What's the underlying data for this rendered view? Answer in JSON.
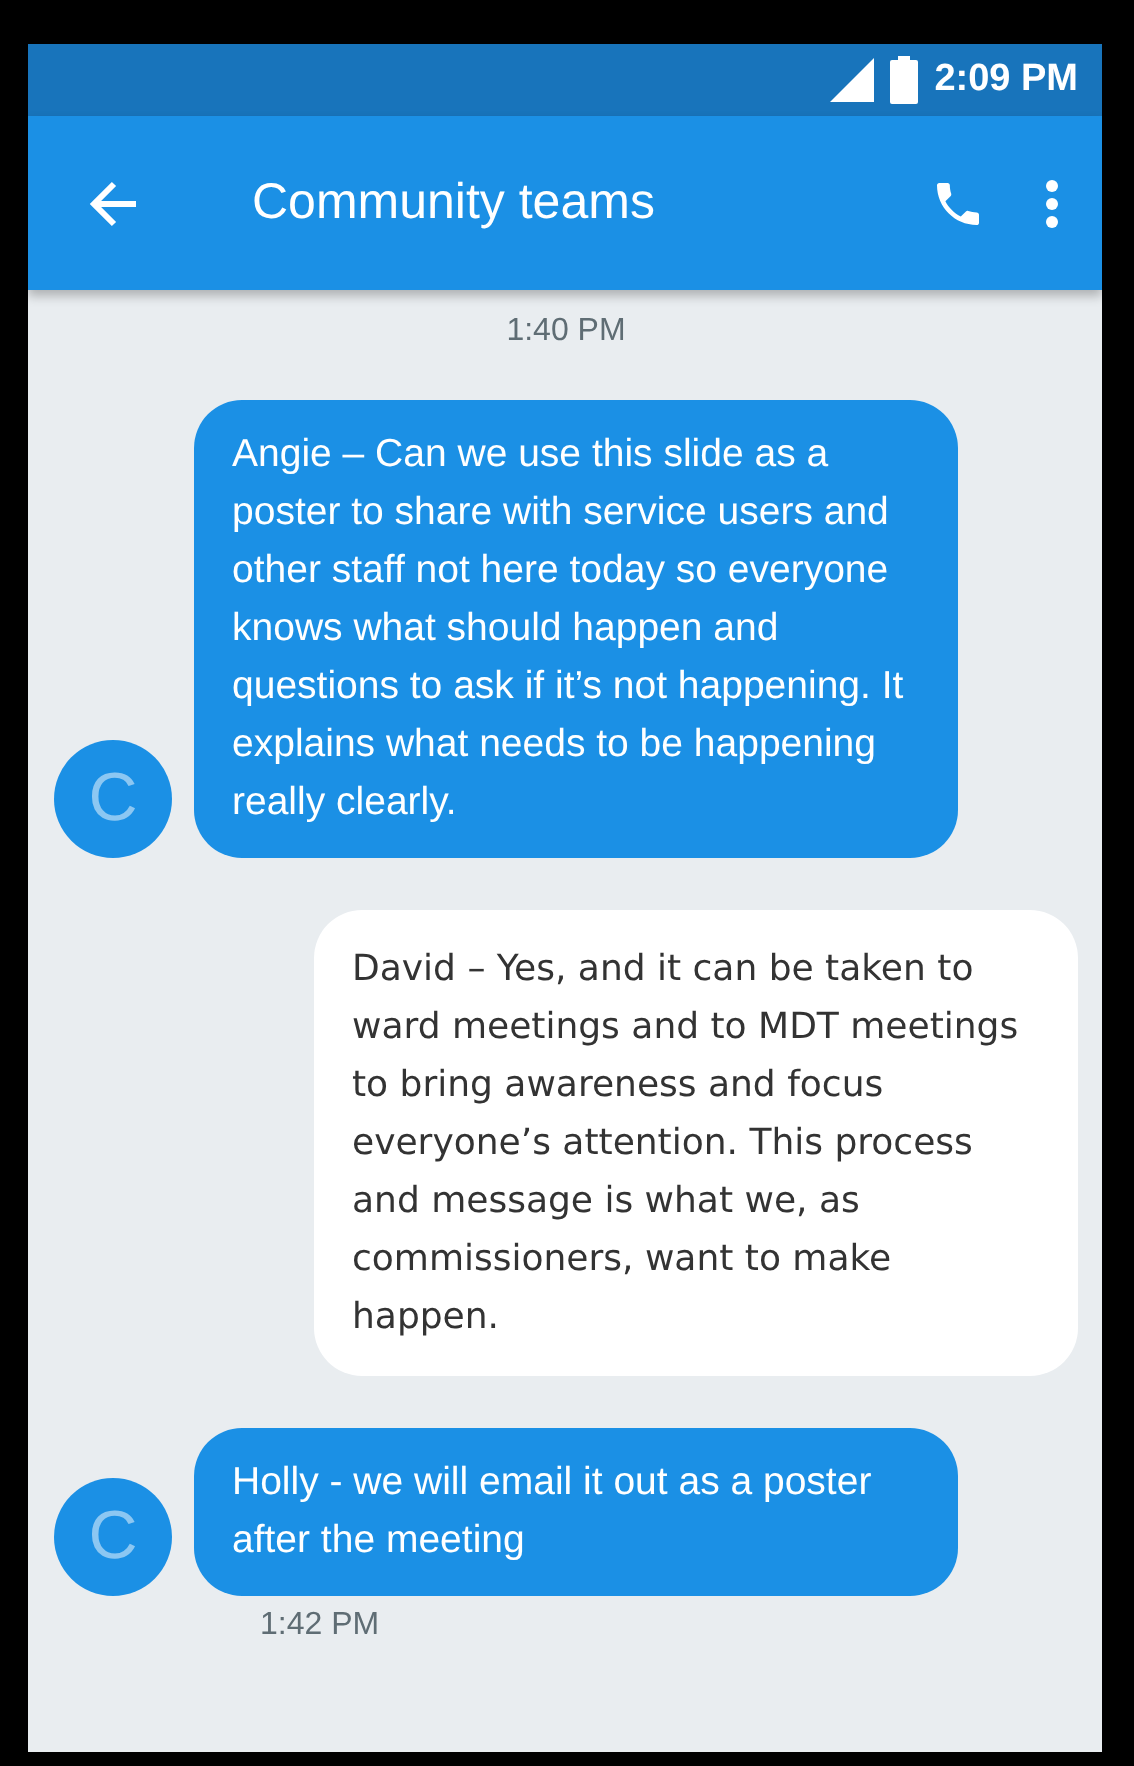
{
  "status_bar": {
    "time": "2:09 PM"
  },
  "app_bar": {
    "title": "Community teams"
  },
  "messages": [
    {
      "kind": "timestamp",
      "text": "1:40 PM"
    },
    {
      "kind": "incoming",
      "avatar": "C",
      "text": "Angie – Can we use this slide as a poster to share with service users and other staff not here today so everyone knows what should happen and questions to ask if it’s not happening. It explains what needs to be happening really clearly."
    },
    {
      "kind": "outgoing",
      "text": "David – Yes, and it can be taken to ward meetings and to MDT meetings to bring awareness and focus everyone’s attention. This process and message is what we, as commissioners, want to make happen."
    },
    {
      "kind": "incoming",
      "avatar": "C",
      "text": "Holly - we will email it out as a poster after the meeting",
      "time": "1:42 PM"
    }
  ]
}
